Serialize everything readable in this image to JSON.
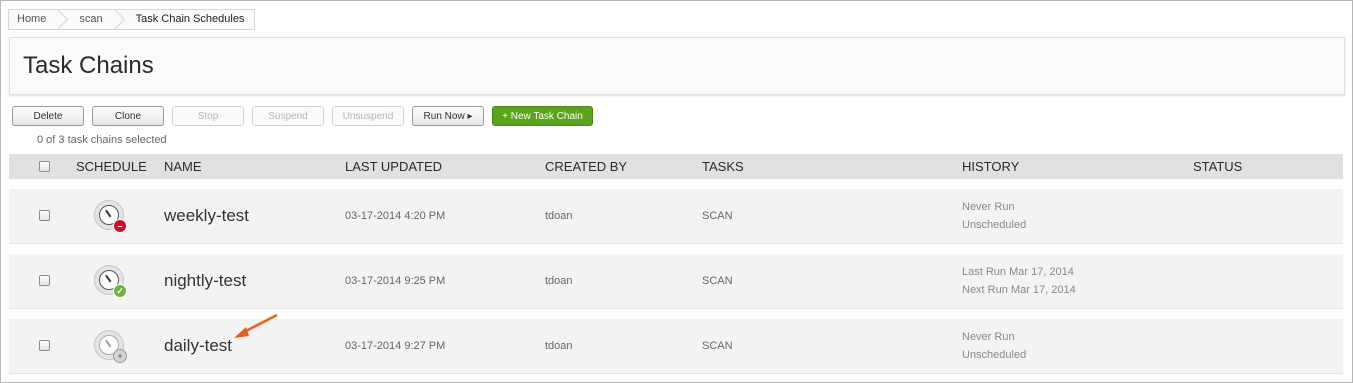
{
  "breadcrumb": [
    "Home",
    "scan",
    "Task Chain Schedules"
  ],
  "page_title": "Task Chains",
  "toolbar": {
    "delete": "Delete",
    "clone": "Clone",
    "stop": "Stop",
    "suspend": "Suspend",
    "unsuspend": "Unsuspend",
    "run_now": "Run Now ▸",
    "new_task_chain": "+ New Task Chain"
  },
  "selection_count": "0 of 3 task chains selected",
  "columns": {
    "schedule": "SCHEDULE",
    "name": "NAME",
    "last_updated": "LAST UPDATED",
    "created_by": "CREATED BY",
    "tasks": "TASKS",
    "history": "HISTORY",
    "status": "STATUS"
  },
  "rows": [
    {
      "schedule_icon": "clock-icon-stopped",
      "badge": "–",
      "name": "weekly-test",
      "last_updated": "03-17-2014 4:20 PM",
      "created_by": "tdoan",
      "tasks": "SCAN",
      "history_line1": "Never Run",
      "history_line2": "Unscheduled",
      "status": ""
    },
    {
      "schedule_icon": "clock-icon-active",
      "badge": "✓",
      "name": "nightly-test",
      "last_updated": "03-17-2014 9:25 PM",
      "created_by": "tdoan",
      "tasks": "SCAN",
      "history_line1": "Last Run Mar 17, 2014",
      "history_line2": "Next Run Mar 17, 2014",
      "status": ""
    },
    {
      "schedule_icon": "clock-icon-unscheduled",
      "badge": "+",
      "name": "daily-test",
      "last_updated": "03-17-2014 9:27 PM",
      "created_by": "tdoan",
      "tasks": "SCAN",
      "history_line1": "Never Run",
      "history_line2": "Unscheduled",
      "status": ""
    }
  ],
  "colors": {
    "accent_green": "#5aa31c",
    "badge_red": "#c8102e",
    "badge_green": "#6cb33f",
    "annotation_arrow": "#e8601c"
  }
}
